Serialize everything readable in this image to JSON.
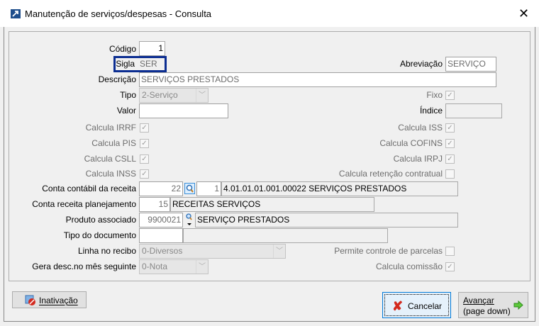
{
  "window": {
    "title": "Manutenção de serviços/despesas - Consulta",
    "close": "✕"
  },
  "form": {
    "codigo": {
      "label": "Código",
      "value": "1"
    },
    "sigla": {
      "label": "Sigla",
      "value": "SER"
    },
    "abreviacao": {
      "label": "Abreviação",
      "value": "SERVIÇO"
    },
    "descricao": {
      "label": "Descrição",
      "value": "SERVIÇOS PRESTADOS"
    },
    "tipo": {
      "label": "Tipo",
      "value": "2-Serviço"
    },
    "fixo": {
      "label": "Fixo",
      "checked": true
    },
    "valor": {
      "label": "Valor",
      "value": ""
    },
    "indice": {
      "label": "Índice",
      "value": ""
    },
    "calcula_irrf": {
      "label": "Calcula IRRF",
      "checked": true
    },
    "calcula_iss": {
      "label": "Calcula ISS",
      "checked": true
    },
    "calcula_pis": {
      "label": "Calcula PIS",
      "checked": true
    },
    "calcula_cofins": {
      "label": "Calcula COFINS",
      "checked": true
    },
    "calcula_csll": {
      "label": "Calcula CSLL",
      "checked": true
    },
    "calcula_irpj": {
      "label": "Calcula IRPJ",
      "checked": true
    },
    "calcula_inss": {
      "label": "Calcula INSS",
      "checked": true
    },
    "calcula_retencao": {
      "label": "Calcula retenção contratual",
      "checked": false
    },
    "conta_contabil": {
      "label": "Conta contábil da receita",
      "code": "22",
      "seq": "1",
      "description": "4.01.01.01.001.00022 SERVIÇOS PRESTADOS"
    },
    "conta_planejamento": {
      "label": "Conta receita planejamento",
      "code": "15",
      "description": "RECEITAS SERVIÇOS"
    },
    "produto": {
      "label": "Produto associado",
      "code": "9900021",
      "description": "SERVIÇO PRESTADOS"
    },
    "tipo_documento": {
      "label": "Tipo do documento",
      "code": "",
      "description": ""
    },
    "linha_recibo": {
      "label": "Linha no recibo",
      "value": "0-Diversos"
    },
    "permite_parcelas": {
      "label": "Permite controle de parcelas",
      "checked": false
    },
    "gera_desc": {
      "label": "Gera desc.no mês seguinte",
      "value": "0-Nota"
    },
    "calcula_comissao": {
      "label": "Calcula comissão",
      "checked": true
    }
  },
  "buttons": {
    "inativacao": "Inativação",
    "cancelar": "Cancelar",
    "avancar_line1": "Avançar",
    "avancar_line2": "(page down)"
  }
}
